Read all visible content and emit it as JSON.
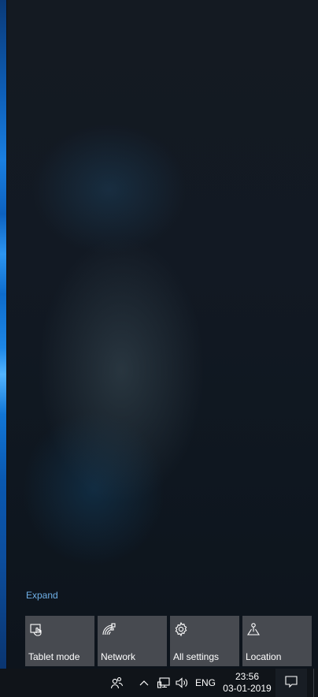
{
  "action_center": {
    "expand_label": "Expand",
    "quick_actions": [
      {
        "label": "Tablet mode",
        "icon": "tablet-mode-icon"
      },
      {
        "label": "Network",
        "icon": "network-icon"
      },
      {
        "label": "All settings",
        "icon": "gear-icon"
      },
      {
        "label": "Location",
        "icon": "location-icon"
      }
    ]
  },
  "taskbar": {
    "language": "ENG",
    "time": "23:56",
    "date": "03-01-2019",
    "icons": [
      "people-icon",
      "chevron-up-icon",
      "network-wired-icon",
      "volume-icon",
      "notification-icon"
    ]
  },
  "colors": {
    "tile_background": "#474a50",
    "link_color": "#6fb0e8",
    "taskbar_background": "#101419"
  }
}
